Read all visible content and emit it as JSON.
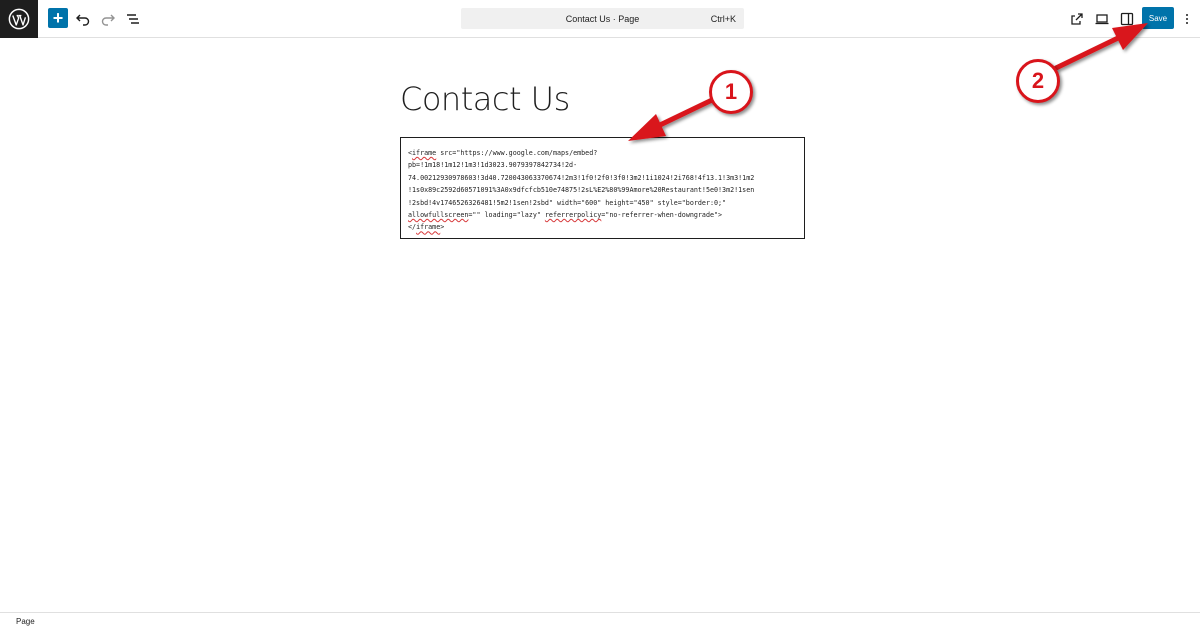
{
  "toolbar": {
    "add_label": "+",
    "document_title": "Contact Us · Page",
    "shortcut": "Ctrl+K",
    "save_label": "Save"
  },
  "content": {
    "title": "Contact Us",
    "code_lines": [
      {
        "pre": "<",
        "err": "iframe",
        "post": " src=\"https://www.google.com/maps/embed?"
      },
      {
        "pre": "pb=!1m18!1m12!1m3!1d3023.9079397842734!2d-",
        "err": "",
        "post": ""
      },
      {
        "pre": "74.00212930978603!3d40.720043063370674!2m3!1f0!2f0!3f0!3m2!1i1024!2i768!4f13.1!3m3!1m2",
        "err": "",
        "post": ""
      },
      {
        "pre": "!1s0x89c2592d60571091%3A0x9dfcfcb510e74875!2sL%E2%80%99Amore%20Restaurant!5e0!3m2!1sen",
        "err": "",
        "post": ""
      },
      {
        "pre": "!2sbd!4v1746526326481!5m2!1sen!2sbd\" width=\"600\" height=\"450\" style=\"border:0;\"",
        "err": "",
        "post": ""
      },
      {
        "pre": "",
        "err": "allowfullscreen",
        "post": "=\"\" loading=\"lazy\" ",
        "err2": "referrerpolicy",
        "post2": "=\"no-referrer-when-downgrade\">"
      },
      {
        "pre": "</",
        "err": "iframe",
        "post": ">"
      }
    ]
  },
  "statusbar": {
    "label": "Page"
  },
  "annotations": {
    "badge1": "1",
    "badge2": "2",
    "color": "#d9141b"
  }
}
